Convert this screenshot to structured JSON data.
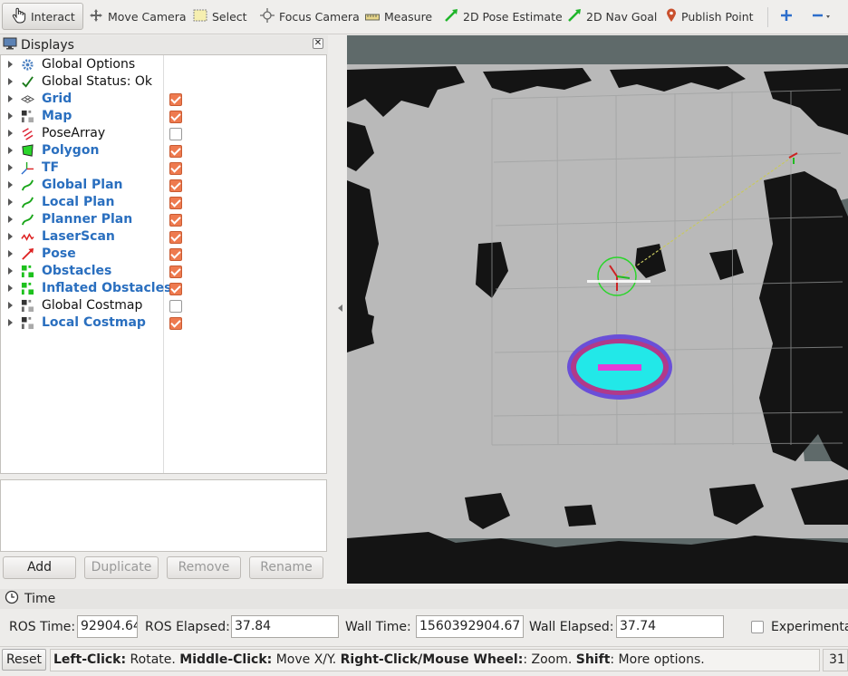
{
  "toolbar": {
    "interact": "Interact",
    "move_camera": "Move Camera",
    "select": "Select",
    "focus_camera": "Focus Camera",
    "measure": "Measure",
    "pose_estimate": "2D Pose Estimate",
    "nav_goal": "2D Nav Goal",
    "publish_point": "Publish Point"
  },
  "displays": {
    "title": "Displays",
    "items": [
      {
        "label": "Global Options",
        "style": "plain",
        "checked": null,
        "icon": "gear-icon"
      },
      {
        "label": "Global Status: Ok",
        "style": "plain",
        "checked": null,
        "icon": "checkmark-icon"
      },
      {
        "label": "Grid",
        "style": "blue",
        "checked": true,
        "icon": "grid-icon"
      },
      {
        "label": "Map",
        "style": "blue",
        "checked": true,
        "icon": "map-icon"
      },
      {
        "label": "PoseArray",
        "style": "plain",
        "checked": false,
        "icon": "pose-array-icon"
      },
      {
        "label": "Polygon",
        "style": "blue",
        "checked": true,
        "icon": "polygon-icon"
      },
      {
        "label": "TF",
        "style": "blue",
        "checked": true,
        "icon": "tf-icon"
      },
      {
        "label": "Global Plan",
        "style": "blue",
        "checked": true,
        "icon": "path-icon"
      },
      {
        "label": "Local Plan",
        "style": "blue",
        "checked": true,
        "icon": "path-icon"
      },
      {
        "label": "Planner Plan",
        "style": "blue",
        "checked": true,
        "icon": "path-icon"
      },
      {
        "label": "LaserScan",
        "style": "blue",
        "checked": true,
        "icon": "laserscan-icon"
      },
      {
        "label": "Pose",
        "style": "blue",
        "checked": true,
        "icon": "pose-icon"
      },
      {
        "label": "Obstacles",
        "style": "blue",
        "checked": true,
        "icon": "grid-cells-icon"
      },
      {
        "label": "Inflated Obstacles",
        "style": "blue",
        "checked": true,
        "icon": "grid-cells-icon"
      },
      {
        "label": "Global Costmap",
        "style": "plain",
        "checked": false,
        "icon": "map-icon"
      },
      {
        "label": "Local Costmap",
        "style": "blue",
        "checked": true,
        "icon": "map-icon"
      }
    ],
    "buttons": {
      "add": "Add",
      "duplicate": "Duplicate",
      "remove": "Remove",
      "rename": "Rename"
    }
  },
  "time": {
    "title": "Time",
    "ros_time_label": "ROS Time:",
    "ros_time_value": "92904.64",
    "ros_elapsed_label": "ROS Elapsed:",
    "ros_elapsed_value": "37.84",
    "wall_time_label": "Wall Time:",
    "wall_time_value": "1560392904.67",
    "wall_elapsed_label": "Wall Elapsed:",
    "wall_elapsed_value": "37.74",
    "experimental_label": "Experimenta"
  },
  "status": {
    "reset": "Reset",
    "hint_parts": [
      {
        "text": "Left-Click:",
        "bold": true
      },
      {
        "text": " Rotate. ",
        "bold": false
      },
      {
        "text": "Middle-Click:",
        "bold": true
      },
      {
        "text": " Move X/Y. ",
        "bold": false
      },
      {
        "text": "Right-Click/Mouse Wheel:",
        "bold": true
      },
      {
        "text": ": Zoom. ",
        "bold": false
      },
      {
        "text": "Shift",
        "bold": true
      },
      {
        "text": ": More options.",
        "bold": false
      }
    ],
    "fps": "31"
  },
  "colors": {
    "accent_checkbox": "#ee7a4f",
    "label_blue": "#2a6fbf",
    "map_free": "#b9b9b9",
    "map_occupied": "#111111",
    "map_unknown": "#5f6a6a",
    "costmap_core": "#22e8e8",
    "costmap_inflation": "#6a4fd8"
  }
}
